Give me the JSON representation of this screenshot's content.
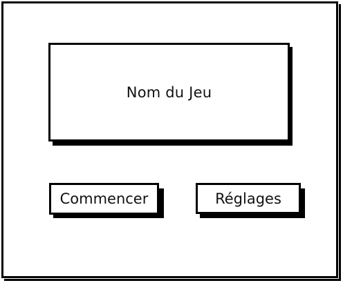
{
  "screen": {
    "game_title": "Nom du Jeu"
  },
  "menu": {
    "start_label": "Commencer",
    "settings_label": "Réglages"
  }
}
